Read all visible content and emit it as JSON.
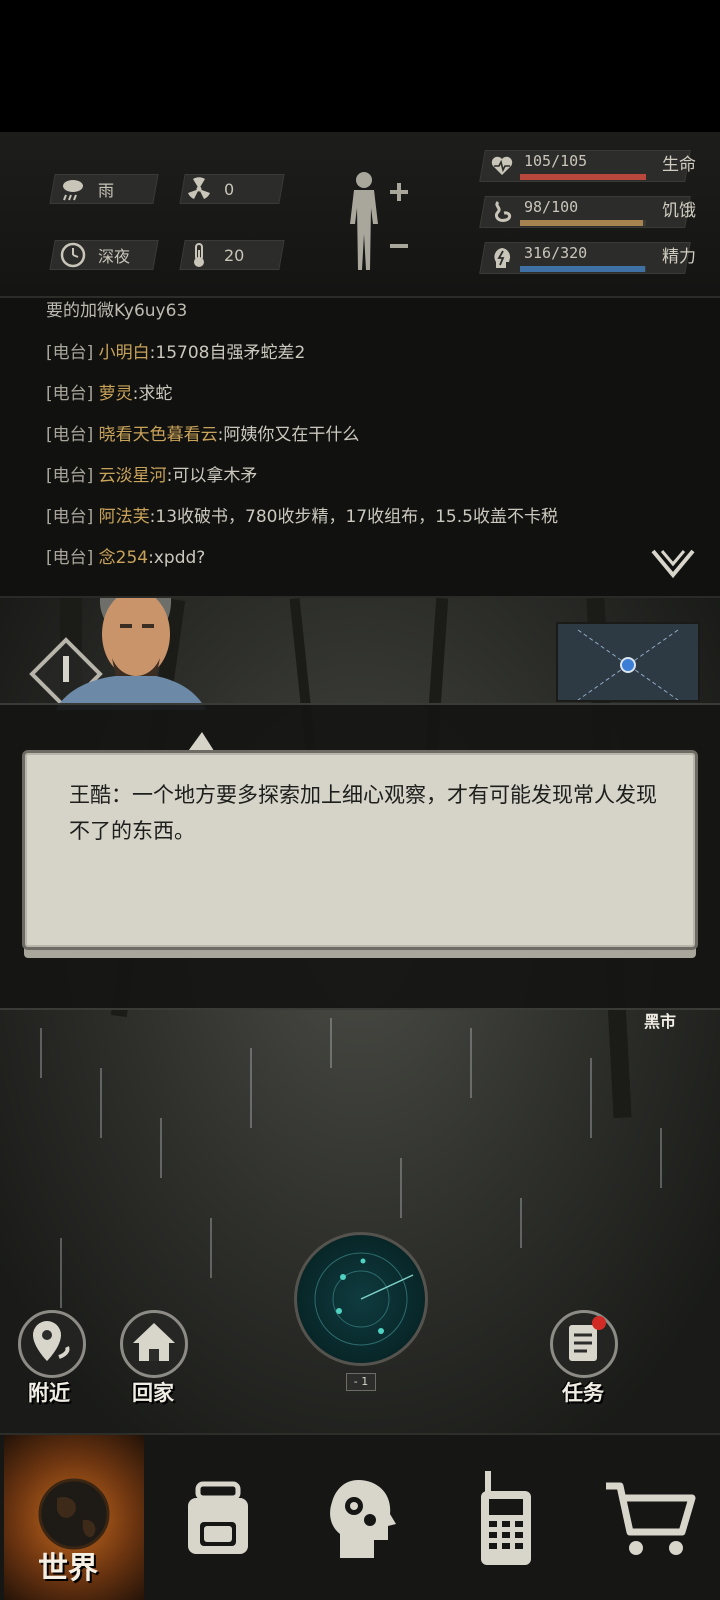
{
  "hud": {
    "weather": "雨",
    "radiation": "0",
    "time_of_day": "深夜",
    "temperature": "20",
    "stats": [
      {
        "value": "105/105",
        "label": "生命",
        "fill": 1.0,
        "color": "#b9473c"
      },
      {
        "value": "98/100",
        "label": "饥饿",
        "fill": 0.98,
        "color": "#a88352"
      },
      {
        "value": "316/320",
        "label": "精力",
        "fill": 0.99,
        "color": "#3f70a6"
      }
    ]
  },
  "chat": {
    "partial_line": "要的加微Ky6uy63",
    "lines": [
      {
        "tag": "[电台]",
        "nick": "小明白",
        "msg": ":15708自强矛蛇差2"
      },
      {
        "tag": "[电台]",
        "nick": "萝灵",
        "msg": ":求蛇"
      },
      {
        "tag": "[电台]",
        "nick": "晓看天色暮看云",
        "msg": ":阿姨你又在干什么"
      },
      {
        "tag": "[电台]",
        "nick": "云淡星河",
        "msg": ":可以拿木矛"
      },
      {
        "tag": "[电台]",
        "nick": "阿法芙",
        "msg": ":13收破书，780收步精，17收组布，15.5收盖不卡税"
      },
      {
        "tag": "[电台]",
        "nick": "念254",
        "msg": ":xpdd?"
      }
    ]
  },
  "dialog": {
    "text": "王酷：一个地方要多探索加上细心观察，才有可能发现常人发现不了的东西。"
  },
  "scene": {
    "black_market_label": "黑市",
    "radar_level": "- 1",
    "nearby_label": "附近",
    "home_label": "回家",
    "tasks_label": "任务"
  },
  "nav": {
    "world_label": "世界"
  }
}
